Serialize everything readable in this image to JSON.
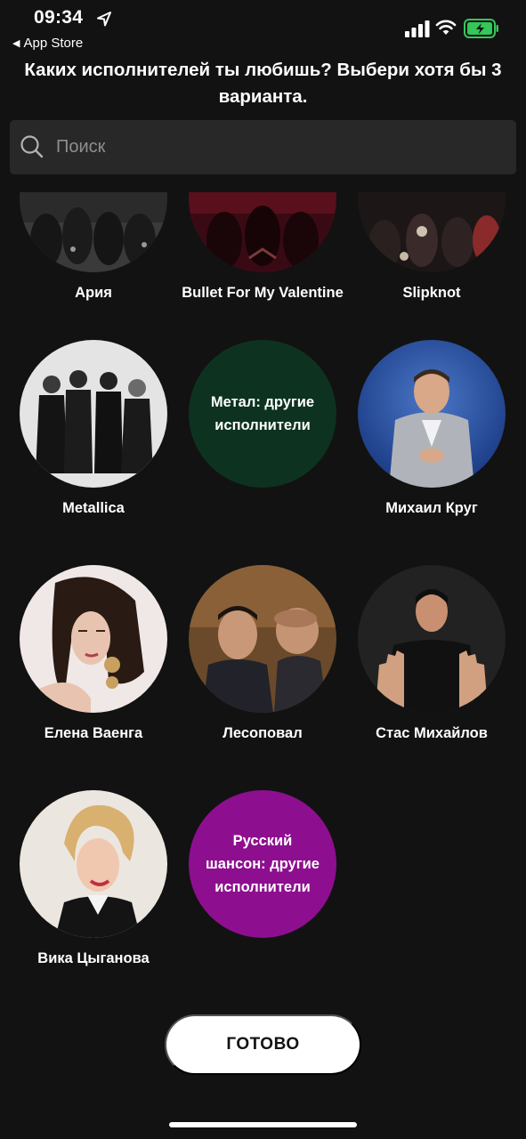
{
  "status_bar": {
    "time": "09:34",
    "back_app": "App Store"
  },
  "header": {
    "title": "Каких исполнителей ты любишь? Выбери хотя бы 3 варианта."
  },
  "search": {
    "placeholder": "Поиск",
    "value": ""
  },
  "artists": [
    {
      "name": "Ария"
    },
    {
      "name": "Bullet For My Valentine"
    },
    {
      "name": "Slipknot"
    },
    {
      "name": "Metallica"
    },
    {
      "name": "",
      "circle_label": "Метал: другие исполнители",
      "color": "#0d3320"
    },
    {
      "name": "Михаил Круг"
    },
    {
      "name": "Елена Ваенга"
    },
    {
      "name": "Лесоповал"
    },
    {
      "name": "Стас Михайлов"
    },
    {
      "name": "Вика Цыганова"
    },
    {
      "name": "",
      "circle_label": "Русский шансон: другие исполнители",
      "color": "#8d0f8f"
    }
  ],
  "footer": {
    "done_label": "ГОТОВО"
  },
  "icons": {
    "location": "location-arrow-icon",
    "back": "back-arrow-icon",
    "signal": "cellular-signal-icon",
    "wifi": "wifi-icon",
    "battery": "battery-charging-icon",
    "search": "search-icon"
  }
}
